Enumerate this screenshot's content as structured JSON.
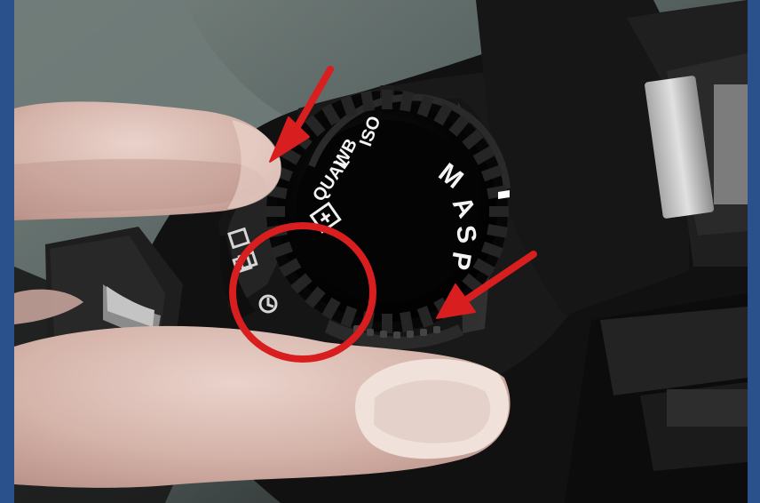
{
  "photo": {
    "subject": "camera-mode-dial",
    "dial_labels": {
      "main": [
        "M",
        "A",
        "S",
        "P"
      ],
      "inner": [
        "ISO",
        "WB",
        "QUAL"
      ]
    },
    "colors": {
      "border": "#2b518d",
      "annotation_red": "#d81e1e",
      "camera_body": "#121212",
      "dial": "#050505",
      "background": "#6f7b78"
    }
  }
}
